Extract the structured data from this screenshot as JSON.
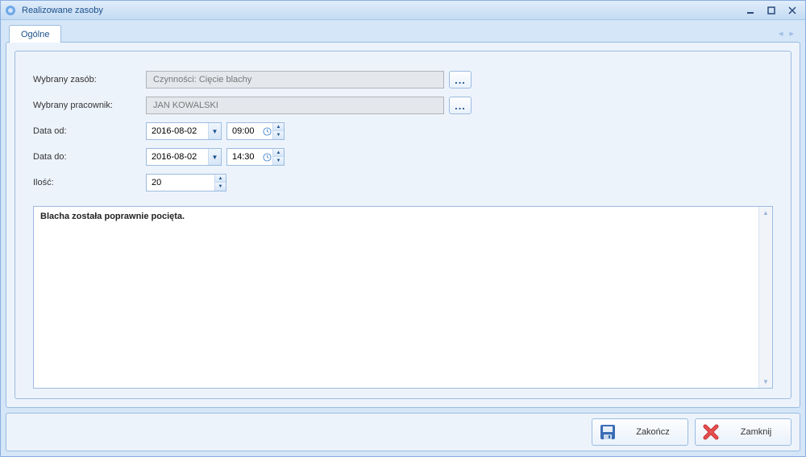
{
  "window": {
    "title": "Realizowane zasoby"
  },
  "tabs": {
    "general": "Ogólne"
  },
  "form": {
    "resource_label": "Wybrany zasób:",
    "resource_value": "Czynności: Cięcie blachy",
    "employee_label": "Wybrany pracownik:",
    "employee_value": "JAN KOWALSKI",
    "date_from_label": "Data od:",
    "date_from_date": "2016-08-02",
    "date_from_time": "09:00",
    "date_to_label": "Data do:",
    "date_to_date": "2016-08-02",
    "date_to_time": "14:30",
    "qty_label": "Ilość:",
    "qty_value": "20",
    "notes": "Blacha została poprawnie pocięta."
  },
  "buttons": {
    "finish": "Zakończ",
    "close": "Zamknij"
  },
  "glyphs": {
    "ellipsis": "...",
    "dropdown": "▼",
    "up": "▲",
    "down": "▼"
  }
}
